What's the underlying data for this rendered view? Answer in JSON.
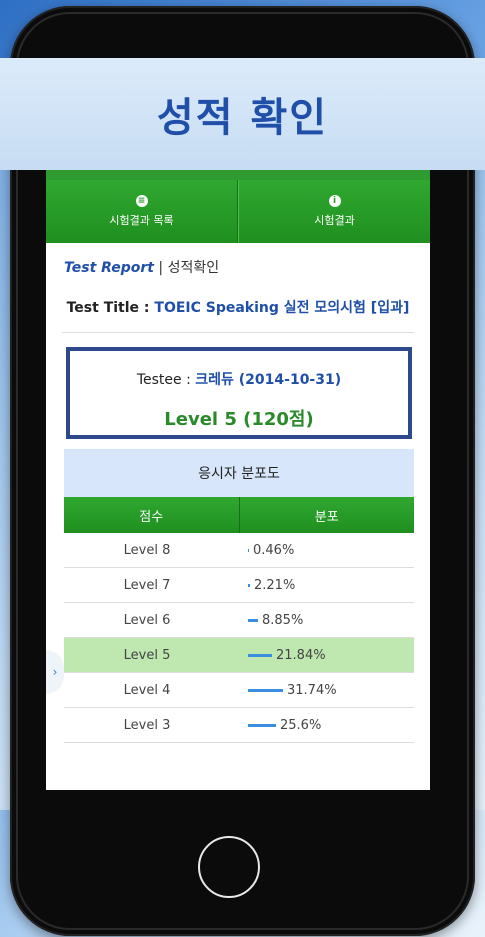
{
  "banner": {
    "title": "성적 확인"
  },
  "nav": {
    "left": {
      "icon": "list-icon",
      "label": "시험결과 목록"
    },
    "right": {
      "icon": "info-icon",
      "label": "시험결과"
    }
  },
  "report": {
    "en": "Test Report",
    "sep": " | ",
    "ko": "성적확인"
  },
  "test_title": {
    "label": "Test Title : ",
    "value": "TOEIC Speaking 실전 모의시험 [입과]"
  },
  "testee": {
    "label": "Testee : ",
    "value": "크레듀 (2014-10-31)",
    "level": "Level 5 (120점)"
  },
  "distribution": {
    "heading": "응시자 분포도",
    "columns": [
      "점수",
      "분포"
    ],
    "rows": [
      {
        "level": "Level 8",
        "pct": "0.46%",
        "value": 0.46,
        "highlight": false
      },
      {
        "level": "Level 7",
        "pct": "2.21%",
        "value": 2.21,
        "highlight": false
      },
      {
        "level": "Level 6",
        "pct": "8.85%",
        "value": 8.85,
        "highlight": false
      },
      {
        "level": "Level 5",
        "pct": "21.84%",
        "value": 21.84,
        "highlight": true
      },
      {
        "level": "Level 4",
        "pct": "31.74%",
        "value": 31.74,
        "highlight": false
      },
      {
        "level": "Level 3",
        "pct": "25.6%",
        "value": 25.6,
        "highlight": false
      }
    ]
  },
  "colors": {
    "green": "#2a9a2a",
    "blue": "#1f4fa8",
    "highlight": "#bfe8b0",
    "bar": "#3a8ee0"
  }
}
